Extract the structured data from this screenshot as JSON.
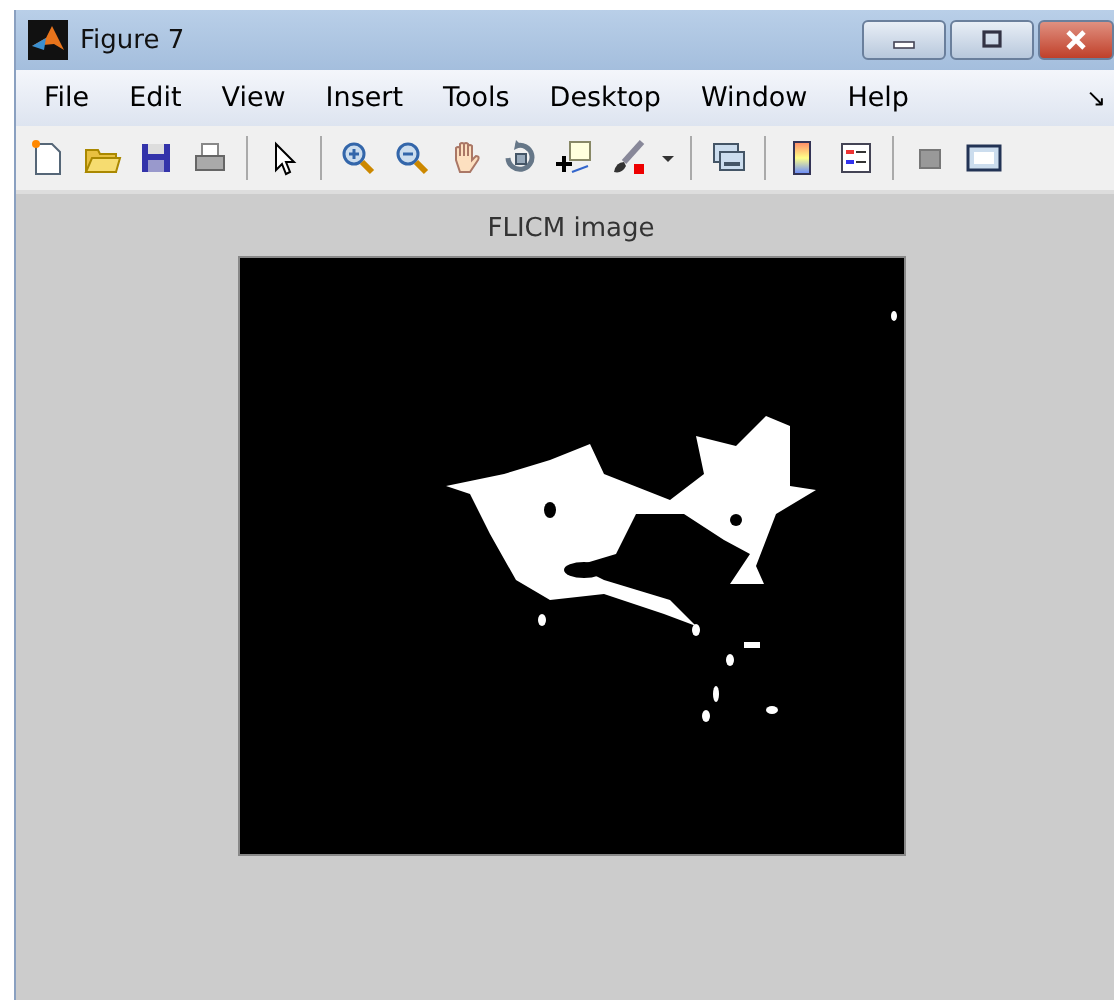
{
  "window": {
    "title": "Figure 7"
  },
  "menu": [
    {
      "label": "File"
    },
    {
      "label": "Edit"
    },
    {
      "label": "View"
    },
    {
      "label": "Insert"
    },
    {
      "label": "Tools"
    },
    {
      "label": "Desktop"
    },
    {
      "label": "Window"
    },
    {
      "label": "Help"
    }
  ],
  "menu_overflow": "↘",
  "axes": {
    "title": "FLICM image"
  }
}
